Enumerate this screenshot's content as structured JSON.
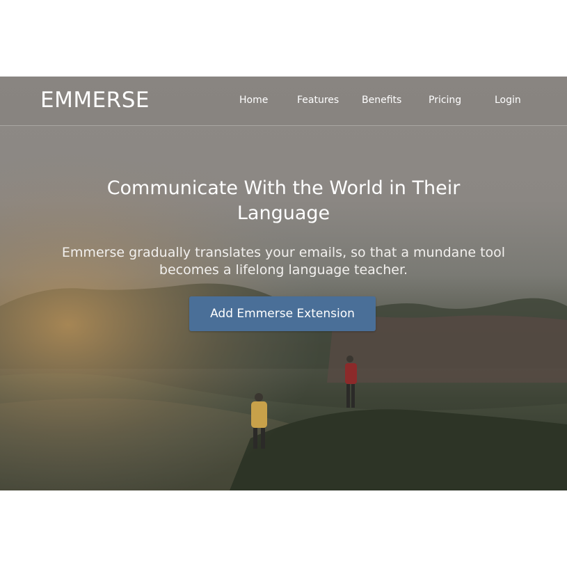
{
  "navbar": {
    "brand": "EMMERSE",
    "links": [
      "Home",
      "Features",
      "Benefits",
      "Pricing",
      "Login"
    ]
  },
  "hero": {
    "title": "Communicate With the World in Their Language",
    "subtitle": "Emmerse gradually translates your emails, so that a mundane tool becomes a lifelong language teacher.",
    "cta_label": "Add Emmerse Extension"
  },
  "colors": {
    "cta_background": "#4a6f98",
    "text": "#ffffff",
    "page_background": "#ffffff"
  }
}
